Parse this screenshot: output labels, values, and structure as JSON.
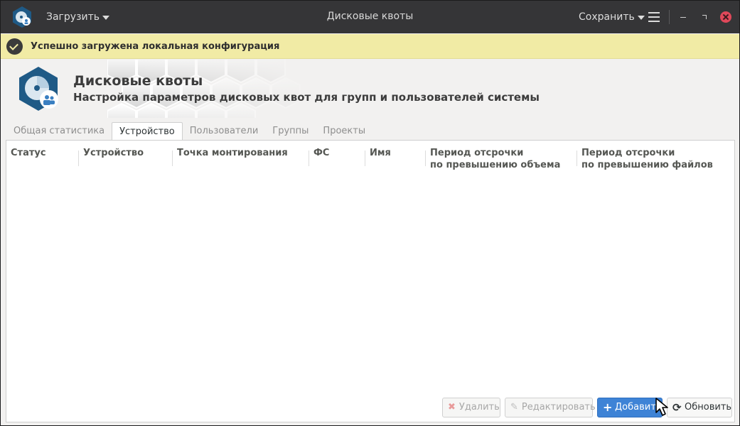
{
  "window": {
    "title": "Дисковые квоты",
    "load_label": "Загрузить",
    "save_label": "Сохранить"
  },
  "infobar": {
    "message": "Успешно загружена локальная конфигурация"
  },
  "banner": {
    "title": "Дисковые квоты",
    "subtitle": "Настройка параметров дисковых квот для групп и пользователей системы"
  },
  "tabs": [
    {
      "label": "Общая статистика",
      "active": false
    },
    {
      "label": "Устройство",
      "active": true
    },
    {
      "label": "Пользователи",
      "active": false
    },
    {
      "label": "Группы",
      "active": false
    },
    {
      "label": "Проекты",
      "active": false
    }
  ],
  "table": {
    "columns": [
      {
        "line1": "Статус",
        "line2": ""
      },
      {
        "line1": "Устройство",
        "line2": ""
      },
      {
        "line1": "Точка монтирования",
        "line2": ""
      },
      {
        "line1": "ФС",
        "line2": ""
      },
      {
        "line1": "Имя",
        "line2": ""
      },
      {
        "line1": "Период отсрочки",
        "line2": "по превышению объема"
      },
      {
        "line1": "Период отсрочки",
        "line2": "по превышению файлов"
      }
    ],
    "rows": []
  },
  "actions": {
    "delete_label": "Удалить",
    "edit_label": "Редактировать",
    "add_label": "Добавить",
    "refresh_label": "Обновить"
  },
  "icons": {
    "app": "disk-quota-icon",
    "info": "checkmark-icon",
    "delete": "x-icon",
    "edit": "pencil-icon",
    "add": "plus-icon",
    "refresh": "refresh-icon"
  },
  "colors": {
    "header": "#353537",
    "infobar": "#f1eba5",
    "accent": "#3e83d6",
    "close": "#e0485a"
  }
}
